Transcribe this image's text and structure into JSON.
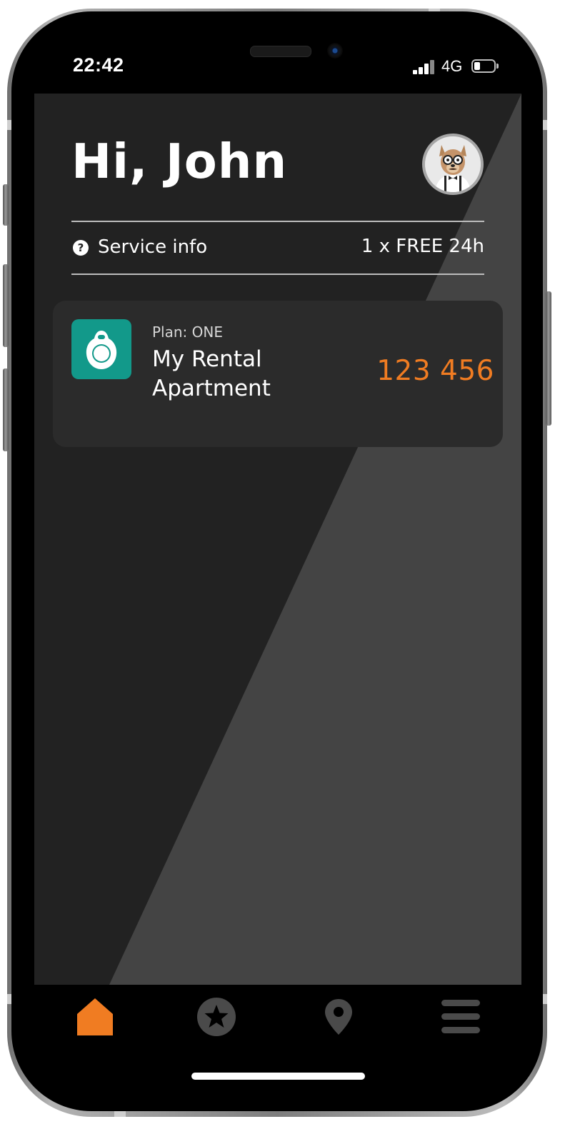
{
  "status_bar": {
    "time": "22:42",
    "network": "4G",
    "battery_level": 0.3
  },
  "header": {
    "greeting": "Hi, John",
    "avatar": "dog-avatar-icon"
  },
  "service": {
    "label": "Service info",
    "free_text": "1 x FREE 24h",
    "icon": "help-icon"
  },
  "card": {
    "plan": "Plan: ONE",
    "name": "My Rental Apartment",
    "code": "123 456",
    "icon": "key-fob-icon"
  },
  "tabs": [
    {
      "name": "home",
      "icon": "home-icon",
      "active": true
    },
    {
      "name": "favorites",
      "icon": "star-icon",
      "active": false
    },
    {
      "name": "locations",
      "icon": "location-pin-icon",
      "active": false
    },
    {
      "name": "menu",
      "icon": "hamburger-menu-icon",
      "active": false
    }
  ],
  "colors": {
    "accent": "#f07c22",
    "teal": "#12998a",
    "background": "#222222",
    "card": "#2b2b2b",
    "tab_inactive": "#4a4a4a"
  }
}
